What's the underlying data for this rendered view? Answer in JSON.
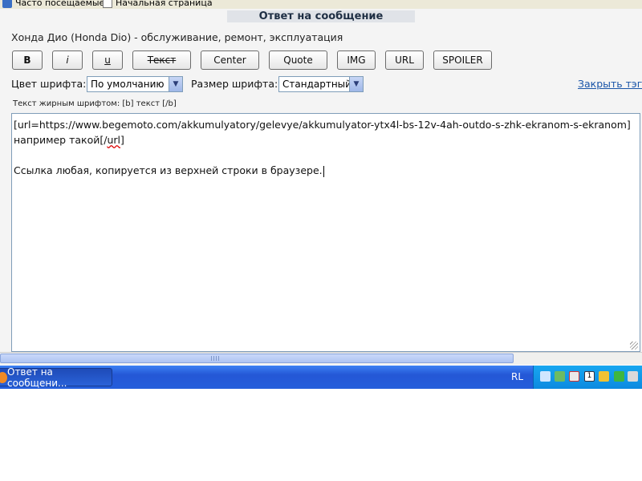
{
  "bookmarks": [
    {
      "label": "Часто посещаемые",
      "icon": "bookmark-star-icon"
    },
    {
      "label": "Начальная страница",
      "icon": "page-icon"
    }
  ],
  "page": {
    "title": "Ответ на сообщение",
    "subject": "Хонда Дио (Honda Dio) - обслуживание, ремонт, эксплуатация"
  },
  "toolbar": {
    "buttons": [
      {
        "label": "B"
      },
      {
        "label": "i"
      },
      {
        "label": "u"
      },
      {
        "label": "Текст"
      },
      {
        "label": "Center"
      },
      {
        "label": "Quote"
      },
      {
        "label": "IMG"
      },
      {
        "label": "URL"
      },
      {
        "label": "SPOILER"
      }
    ]
  },
  "font": {
    "color_label": "Цвет шрифта:",
    "color_value": "По умолчанию",
    "size_label": "Размер шрифта:",
    "size_value": "Стандартный",
    "close_tags": "Закрыть тэги"
  },
  "hint": "Текст жирным шрифтом: [b] текст [/b]",
  "editor": {
    "line1": "[url=https://www.begemoto.com/akkumulyatory/gelevye/akkumulyator-ytx4l-bs-12v-4ah-outdo-s-zhk-ekranom-s-ekranom]",
    "line2_text": "например такой[/",
    "line2_squiggle": "url",
    "line2_end": "]",
    "line3": "Ссылка любая, копируется из верхней строки в браузере."
  },
  "taskbar": {
    "task_label": "Ответ на сообщени...",
    "language": "RL",
    "tray_number": "1"
  },
  "colors": {
    "taskbar_blue": "#245edb",
    "tray_blue": "#0c8ae0",
    "link_blue": "#1a55a8"
  }
}
